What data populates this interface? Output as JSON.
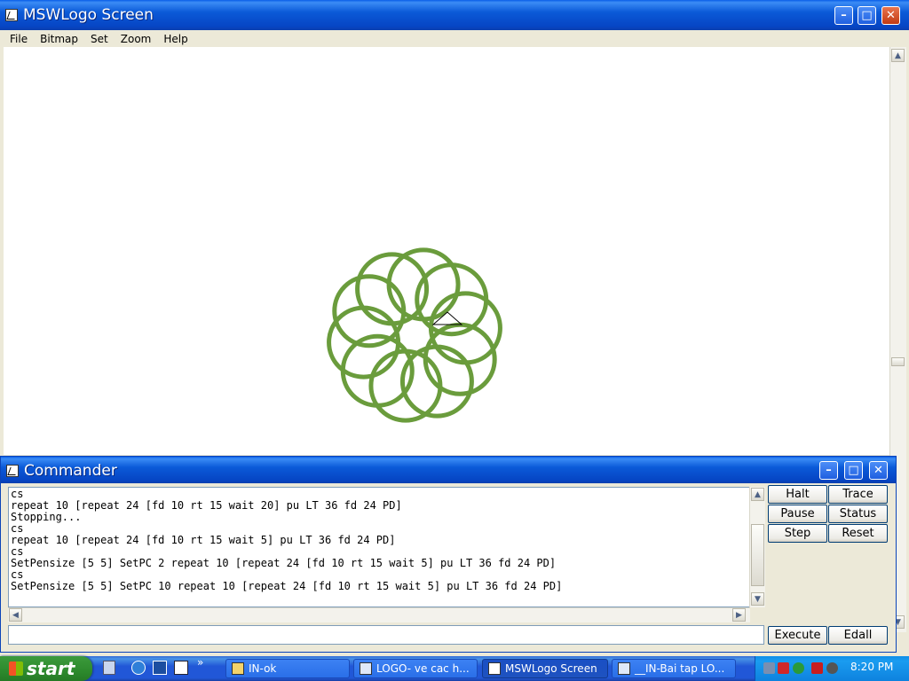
{
  "main_window": {
    "title": "MSWLogo Screen",
    "menu": [
      "File",
      "Bitmap",
      "Set",
      "Zoom",
      "Help"
    ]
  },
  "drawing": {
    "pen_color": "#6a9c3c",
    "pen_width": 5,
    "loops": 10,
    "circle_center_distance": 58,
    "circle_radius": 39
  },
  "commander": {
    "title": "Commander",
    "log": [
      "cs",
      "repeat 10 [repeat 24 [fd 10 rt 15 wait 20] pu LT 36 fd 24 PD]",
      "Stopping...",
      "cs",
      "repeat 10 [repeat 24 [fd 10 rt 15 wait 5] pu LT 36 fd 24 PD]",
      "cs",
      "SetPensize [5 5] SetPC 2 repeat 10 [repeat 24 [fd 10 rt 15 wait 5] pu LT 36 fd 24 PD]",
      "cs",
      "SetPensize [5 5] SetPC 10 repeat 10 [repeat 24 [fd 10 rt 15 wait 5] pu LT 36 fd 24 PD]"
    ],
    "input_value": "",
    "buttons": {
      "halt": "Halt",
      "trace": "Trace",
      "pause": "Pause",
      "status": "Status",
      "step": "Step",
      "reset": "Reset",
      "execute": "Execute",
      "edall": "Edall"
    }
  },
  "taskbar": {
    "start_label": "start",
    "items": [
      {
        "label": "IN-ok"
      },
      {
        "label": "LOGO- ve cac h..."
      },
      {
        "label": "MSWLogo Screen"
      },
      {
        "label": "__IN-Bai tap LO..."
      }
    ],
    "clock": "8:20 PM"
  }
}
